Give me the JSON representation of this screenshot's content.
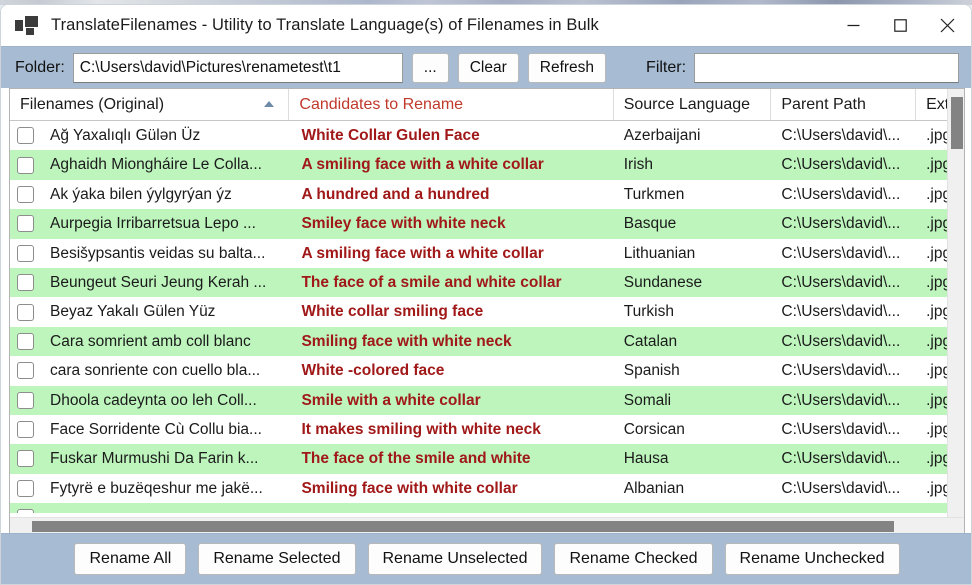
{
  "window": {
    "title": "TranslateFilenames - Utility to Translate Language(s) of Filenames in Bulk",
    "icon": "app-tiles-icon",
    "minimize_label": "—",
    "maximize_label": "□",
    "close_label": "✕"
  },
  "toolbar": {
    "folder_label": "Folder:",
    "folder_value": "C:\\Users\\david\\Pictures\\renametest\\t1",
    "folder_placeholder": "",
    "browse_label": "...",
    "clear_label": "Clear",
    "refresh_label": "Refresh",
    "filter_label": "Filter:",
    "filter_value": "",
    "filter_placeholder": ""
  },
  "grid": {
    "columns": [
      {
        "key": "original",
        "label": "Filenames (Original)",
        "sort": "ascending"
      },
      {
        "key": "candidate",
        "label": "Candidates to Rename"
      },
      {
        "key": "language",
        "label": "Source Language"
      },
      {
        "key": "parent",
        "label": "Parent Path"
      },
      {
        "key": "ext",
        "label": "Ext"
      }
    ],
    "rows": [
      {
        "checked": false,
        "original": "Ağ Yaxalıqlı Gülən Üz",
        "candidate": "White Collar Gulen Face",
        "language": "Azerbaijani",
        "parent": "C:\\Users\\david\\...",
        "ext": ".jpg"
      },
      {
        "checked": false,
        "original": "Aghaidh Miongháire Le Colla...",
        "candidate": "A smiling face with a white collar",
        "language": "Irish",
        "parent": "C:\\Users\\david\\...",
        "ext": ".jpg"
      },
      {
        "checked": false,
        "original": "Ak ýaka bilen ýylgyrýan ýz",
        "candidate": "A hundred and a hundred",
        "language": "Turkmen",
        "parent": "C:\\Users\\david\\...",
        "ext": ".jpg"
      },
      {
        "checked": false,
        "original": "Aurpegia Irribarretsua Lepo ...",
        "candidate": "Smiley face with white neck",
        "language": "Basque",
        "parent": "C:\\Users\\david\\...",
        "ext": ".jpg"
      },
      {
        "checked": false,
        "original": "Besišypsantis veidas su balta...",
        "candidate": "A smiling face with a white collar",
        "language": "Lithuanian",
        "parent": "C:\\Users\\david\\...",
        "ext": ".jpg"
      },
      {
        "checked": false,
        "original": "Beungeut Seuri Jeung Kerah ...",
        "candidate": "The face of a smile and white collar",
        "language": "Sundanese",
        "parent": "C:\\Users\\david\\...",
        "ext": ".jpg"
      },
      {
        "checked": false,
        "original": "Beyaz Yakalı Gülen Yüz",
        "candidate": "White collar smiling face",
        "language": "Turkish",
        "parent": "C:\\Users\\david\\...",
        "ext": ".jpg"
      },
      {
        "checked": false,
        "original": "Cara somrient amb coll blanc",
        "candidate": "Smiling face with white neck",
        "language": "Catalan",
        "parent": "C:\\Users\\david\\...",
        "ext": ".jpg"
      },
      {
        "checked": false,
        "original": "cara sonriente con cuello bla...",
        "candidate": "White -colored face",
        "language": "Spanish",
        "parent": "C:\\Users\\david\\...",
        "ext": ".jpg"
      },
      {
        "checked": false,
        "original": "Dhoola cadeynta oo leh Coll...",
        "candidate": "Smile with a white collar",
        "language": "Somali",
        "parent": "C:\\Users\\david\\...",
        "ext": ".jpg"
      },
      {
        "checked": false,
        "original": "Face Sorridente Cù Collu bia...",
        "candidate": "It makes smiling with white neck",
        "language": "Corsican",
        "parent": "C:\\Users\\david\\...",
        "ext": ".jpg"
      },
      {
        "checked": false,
        "original": "Fuskar Murmushi Da Farin k...",
        "candidate": "The face of the smile and white",
        "language": "Hausa",
        "parent": "C:\\Users\\david\\...",
        "ext": ".jpg"
      },
      {
        "checked": false,
        "original": "Fytyrë e buzëqeshur me jakë...",
        "candidate": "Smiling face with white collar",
        "language": "Albanian",
        "parent": "C:\\Users\\david\\...",
        "ext": ".jpg"
      },
      {
        "checked": false,
        "original": "",
        "candidate": "",
        "language": "",
        "parent": "",
        "ext": ""
      }
    ]
  },
  "footer": {
    "buttons": [
      {
        "key": "rename-all",
        "label": "Rename All"
      },
      {
        "key": "rename-selected",
        "label": "Rename Selected"
      },
      {
        "key": "rename-unselected",
        "label": "Rename Unselected"
      },
      {
        "key": "rename-checked",
        "label": "Rename Checked"
      },
      {
        "key": "rename-unchecked",
        "label": "Rename Unchecked"
      }
    ]
  },
  "colors": {
    "toolbar_background": "#a7bcd3",
    "candidate_text": "#a01818",
    "candidate_header": "#c0392b",
    "row_alt_background": "#bdf5bd",
    "scrollbar_thumb": "#838383"
  }
}
